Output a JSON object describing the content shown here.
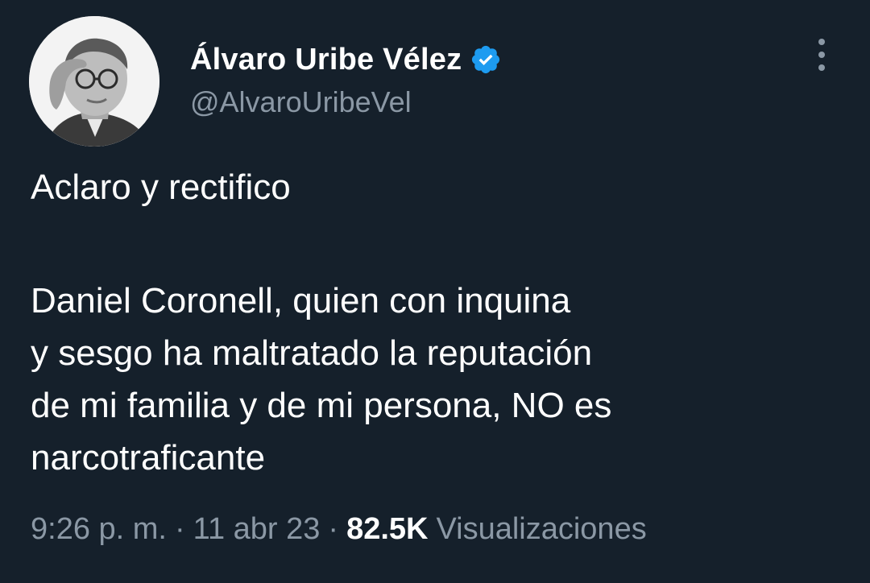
{
  "author": {
    "display_name": "Álvaro Uribe Vélez",
    "handle": "@AlvaroUribeVel",
    "verified": true,
    "avatar_icon": "profile-photo"
  },
  "tweet": {
    "lines": [
      "Aclaro y rectifico",
      "",
      "Daniel Coronell, quien con inquina",
      "y sesgo ha maltratado la reputación",
      "de mi familia y de mi persona, NO es",
      "narcotraficante"
    ],
    "time": "9:26 p. m.",
    "date": "11 abr 23",
    "separator": "·",
    "views_count": "82.5K",
    "views_label": "Visualizaciones"
  },
  "colors": {
    "background": "#15202b",
    "primary_text": "#ffffff",
    "secondary_text": "#8b98a5",
    "verified_badge": "#1d9bf0"
  },
  "icons": {
    "verified": "verified-badge-icon",
    "more": "more-options-icon"
  }
}
